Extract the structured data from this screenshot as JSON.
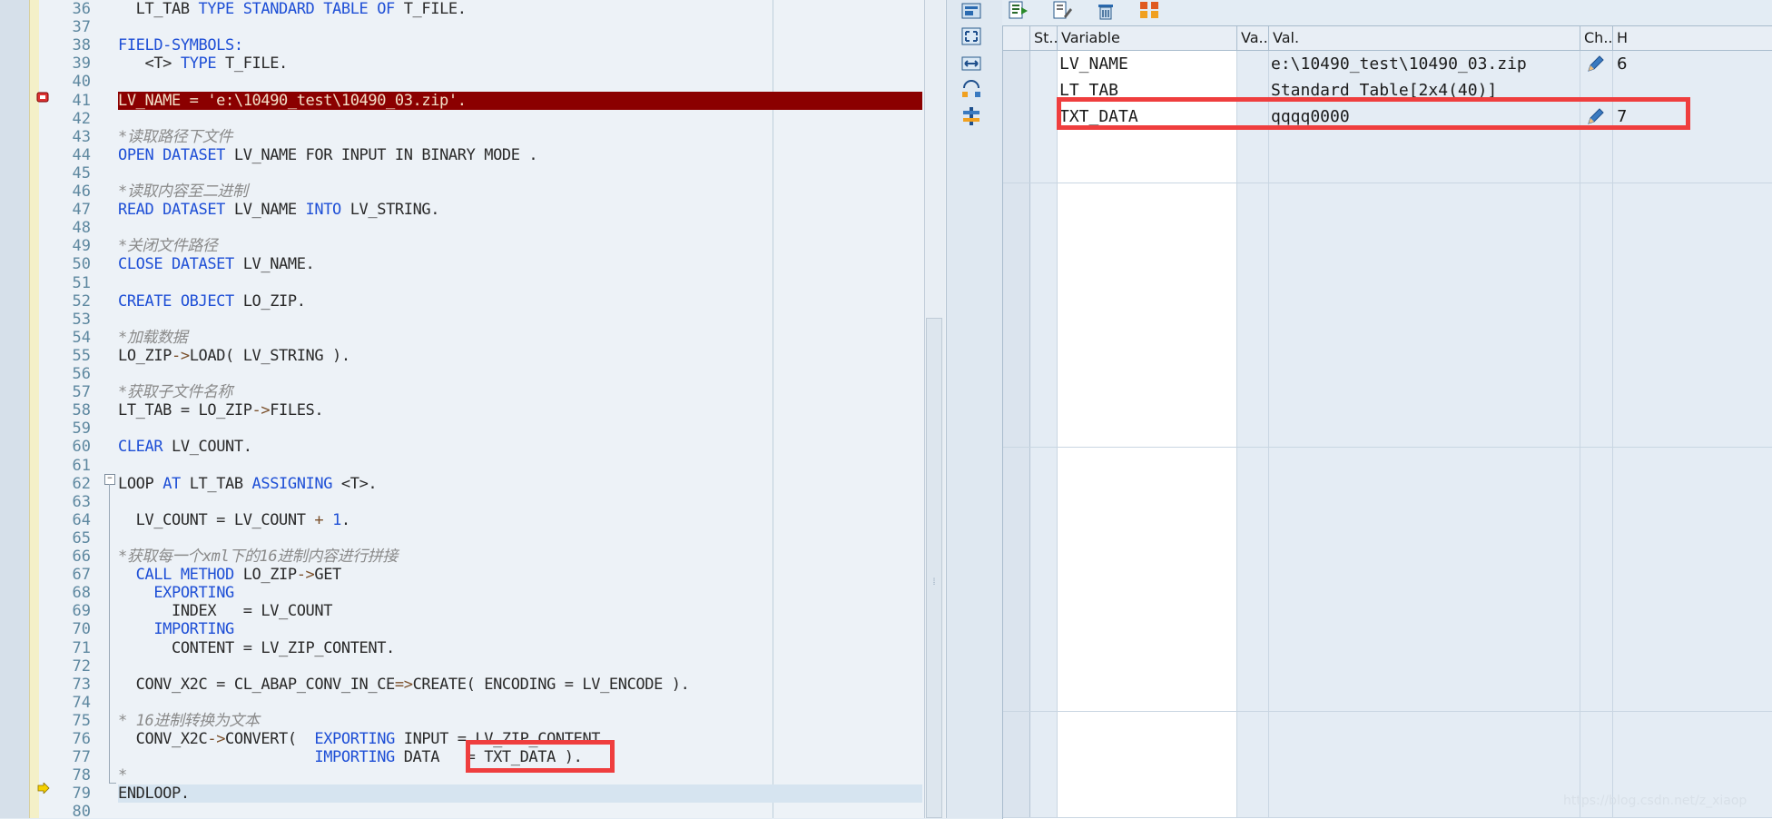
{
  "editor": {
    "lines": [
      {
        "n": "36",
        "t": [
          [
            "  LT_TAB ",
            ""
          ],
          [
            "TYPE STANDARD TABLE OF",
            "kw"
          ],
          [
            " T_FILE.",
            ""
          ]
        ]
      },
      {
        "n": "37",
        "t": []
      },
      {
        "n": "38",
        "t": [
          [
            "FIELD-SYMBOLS:",
            "kw"
          ]
        ]
      },
      {
        "n": "39",
        "t": [
          [
            "   <T> ",
            ""
          ],
          [
            "TYPE",
            "kw"
          ],
          [
            " T_FILE.",
            ""
          ]
        ]
      },
      {
        "n": "40",
        "t": []
      },
      {
        "n": "41",
        "t": [
          [
            "LV_NAME = 'e:\\10490_test\\10490_03.zip'.",
            ""
          ]
        ],
        "hl": "red"
      },
      {
        "n": "42",
        "t": []
      },
      {
        "n": "43",
        "t": [
          [
            "*读取路径下文件",
            "cm"
          ]
        ]
      },
      {
        "n": "44",
        "t": [
          [
            "OPEN DATASET",
            "kw"
          ],
          [
            " LV_NAME ",
            ""
          ],
          [
            "FOR INPUT IN BINARY MODE",
            ""
          ],
          [
            " .",
            ""
          ]
        ]
      },
      {
        "n": "45",
        "t": []
      },
      {
        "n": "46",
        "t": [
          [
            "*读取内容至二进制",
            "cm"
          ]
        ]
      },
      {
        "n": "47",
        "t": [
          [
            "READ DATASET",
            "kw"
          ],
          [
            " LV_NAME ",
            ""
          ],
          [
            "INTO",
            "kw"
          ],
          [
            " LV_STRING.",
            ""
          ]
        ]
      },
      {
        "n": "48",
        "t": []
      },
      {
        "n": "49",
        "t": [
          [
            "*关闭文件路径",
            "cm"
          ]
        ]
      },
      {
        "n": "50",
        "t": [
          [
            "CLOSE DATASET",
            "kw"
          ],
          [
            " LV_NAME.",
            ""
          ]
        ]
      },
      {
        "n": "51",
        "t": []
      },
      {
        "n": "52",
        "t": [
          [
            "CREATE OBJECT",
            "kw"
          ],
          [
            " LO_ZIP.",
            ""
          ]
        ]
      },
      {
        "n": "53",
        "t": []
      },
      {
        "n": "54",
        "t": [
          [
            "*加载数据",
            "cm"
          ]
        ]
      },
      {
        "n": "55",
        "t": [
          [
            "LO_ZIP",
            ""
          ],
          [
            "->",
            "op"
          ],
          [
            "LOAD( LV_STRING ).",
            ""
          ]
        ]
      },
      {
        "n": "56",
        "t": []
      },
      {
        "n": "57",
        "t": [
          [
            "*获取子文件名称",
            "cm"
          ]
        ]
      },
      {
        "n": "58",
        "t": [
          [
            "LT_TAB = LO_ZIP",
            ""
          ],
          [
            "->",
            "op"
          ],
          [
            "FILES.",
            ""
          ]
        ]
      },
      {
        "n": "59",
        "t": []
      },
      {
        "n": "60",
        "t": [
          [
            "CLEAR",
            "kw"
          ],
          [
            " LV_COUNT.",
            ""
          ]
        ]
      },
      {
        "n": "61",
        "t": []
      },
      {
        "n": "62",
        "t": [
          [
            "LOOP ",
            ""
          ],
          [
            "AT",
            "kw"
          ],
          [
            " LT_TAB ",
            ""
          ],
          [
            "ASSIGNING",
            "kw"
          ],
          [
            " <T>.",
            ""
          ]
        ]
      },
      {
        "n": "63",
        "t": []
      },
      {
        "n": "64",
        "t": [
          [
            "  LV_COUNT = LV_COUNT ",
            ""
          ],
          [
            "+",
            "op"
          ],
          [
            " ",
            ""
          ],
          [
            "1",
            "num"
          ],
          [
            ".",
            ""
          ]
        ]
      },
      {
        "n": "65",
        "t": []
      },
      {
        "n": "66",
        "t": [
          [
            "*获取每一个xml下的16进制内容进行拼接",
            "cm"
          ]
        ]
      },
      {
        "n": "67",
        "t": [
          [
            "  ",
            ""
          ],
          [
            "CALL METHOD",
            "kw"
          ],
          [
            " LO_ZIP",
            ""
          ],
          [
            "->",
            "op"
          ],
          [
            "GET",
            ""
          ]
        ]
      },
      {
        "n": "68",
        "t": [
          [
            "    ",
            ""
          ],
          [
            "EXPORTING",
            "kw"
          ]
        ]
      },
      {
        "n": "69",
        "t": [
          [
            "      INDEX   = LV_COUNT",
            ""
          ]
        ]
      },
      {
        "n": "70",
        "t": [
          [
            "    ",
            ""
          ],
          [
            "IMPORTING",
            "kw"
          ]
        ]
      },
      {
        "n": "71",
        "t": [
          [
            "      CONTENT = LV_ZIP_CONTENT.",
            ""
          ]
        ]
      },
      {
        "n": "72",
        "t": []
      },
      {
        "n": "73",
        "t": [
          [
            "  CONV_X2C = CL_ABAP_CONV_IN_CE",
            ""
          ],
          [
            "=>",
            "op"
          ],
          [
            "CREATE( ENCODING = LV_ENCODE ).",
            ""
          ]
        ]
      },
      {
        "n": "74",
        "t": []
      },
      {
        "n": "75",
        "t": [
          [
            "* 16进制转换为文本",
            "cm"
          ]
        ]
      },
      {
        "n": "76",
        "t": [
          [
            "  CONV_X2C",
            ""
          ],
          [
            "->",
            "op"
          ],
          [
            "CONVERT(  ",
            ""
          ],
          [
            "EXPORTING",
            "kw"
          ],
          [
            " INPUT = LV_ZIP_CONTENT",
            ""
          ]
        ]
      },
      {
        "n": "77",
        "t": [
          [
            "                      ",
            ""
          ],
          [
            "IMPORTING",
            "kw"
          ],
          [
            " DATA   = TXT_DATA ).",
            ""
          ]
        ]
      },
      {
        "n": "78",
        "t": [
          [
            "*",
            "cm"
          ]
        ]
      },
      {
        "n": "79",
        "t": [
          [
            "ENDLOOP.",
            ""
          ]
        ],
        "hl": "blue"
      },
      {
        "n": "80",
        "t": []
      }
    ]
  },
  "variables": {
    "headers": {
      "st": "St...",
      "var": "Variable",
      "va": "Va...",
      "val": "Val.",
      "ch": "Ch...",
      "h": "H"
    },
    "rows": [
      {
        "var": "LV_NAME",
        "val": "e:\\10490_test\\10490_03.zip",
        "h": "6",
        "edit": true
      },
      {
        "var": "LT_TAB",
        "val": "Standard Table[2x4(40)]",
        "h": "",
        "edit": false
      },
      {
        "var": "TXT_DATA",
        "val": "qqqq0000",
        "h": "7",
        "edit": true
      }
    ]
  },
  "watermark": "https://blog.csdn.net/z_xiaop",
  "colors": {
    "breakpoint_line": "#8b0000",
    "annotation": "#ef3e3e"
  }
}
